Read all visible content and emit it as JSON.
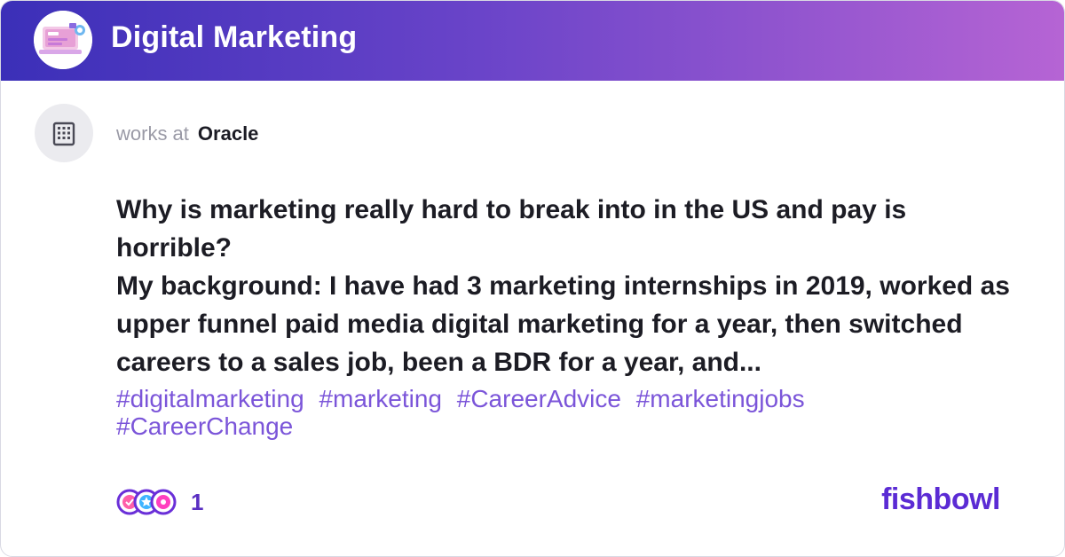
{
  "header": {
    "bowl_name": "Digital Marketing",
    "bowl_icon": "laptop-illustration-icon"
  },
  "author": {
    "works_at_label": "works at",
    "company": "Oracle",
    "avatar_icon": "building-icon"
  },
  "post": {
    "title": "Why is marketing really hard to break into in the US and pay is horrible?",
    "body": "My background: I have had 3 marketing internships in 2019, worked as upper funnel paid media digital marketing for a year, then switched careers to a sales job, been a BDR for a year, and...",
    "tags": [
      "#digitalmarketing",
      "#marketing",
      "#CareerAdvice",
      "#marketingjobs",
      "#CareerChange"
    ]
  },
  "reactions": {
    "count": "1",
    "icons": [
      "like-reaction-icon",
      "star-reaction-icon",
      "celebrate-reaction-icon"
    ]
  },
  "brand": {
    "name": "fishbowl"
  },
  "colors": {
    "header_gradient_start": "#3b2fb8",
    "header_gradient_end": "#b664d4",
    "tag_color": "#7b55d9",
    "brand_color": "#5b2bd4"
  }
}
